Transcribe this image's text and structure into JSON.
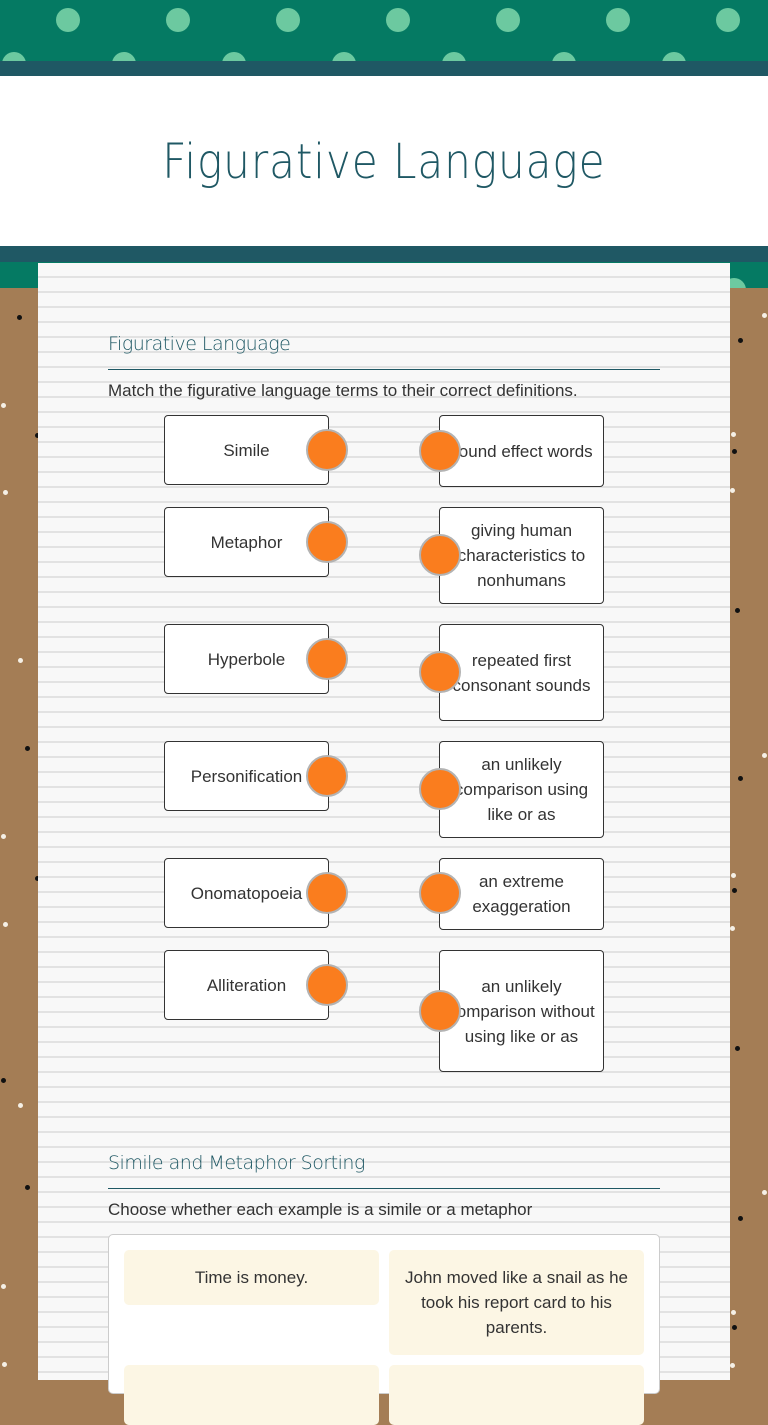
{
  "header": {
    "title": "Figurative Language"
  },
  "colors": {
    "banner": "#057a63",
    "banner_dot": "#6cc9a0",
    "stripe": "#1f5864",
    "connector": "#fa7d1e",
    "cork": "#a47d55",
    "sort_card": "#fcf6e4"
  },
  "sections": [
    {
      "title": "Figurative Language",
      "instructions": "Match the figurative language terms to their correct definitions.",
      "terms": [
        {
          "label": "Simile"
        },
        {
          "label": "Metaphor"
        },
        {
          "label": "Hyperbole"
        },
        {
          "label": "Personification"
        },
        {
          "label": "Onomatopoeia"
        },
        {
          "label": "Alliteration"
        }
      ],
      "definitions": [
        {
          "label": "sound effect words"
        },
        {
          "label": "giving human characteristics to nonhumans"
        },
        {
          "label": "repeated first consonant sounds"
        },
        {
          "label": "an unlikely comparison using like or as"
        },
        {
          "label": "an extreme exaggeration"
        },
        {
          "label": "an unlikely comparison without using like or as"
        }
      ]
    },
    {
      "title": "Simile and Metaphor Sorting",
      "instructions": "Choose whether each example is a simile or a metaphor",
      "cards": [
        {
          "label": "Time is money."
        },
        {
          "label": "John moved like a snail as he took his report card to his parents."
        },
        {
          "label": ""
        },
        {
          "label": ""
        }
      ]
    }
  ]
}
